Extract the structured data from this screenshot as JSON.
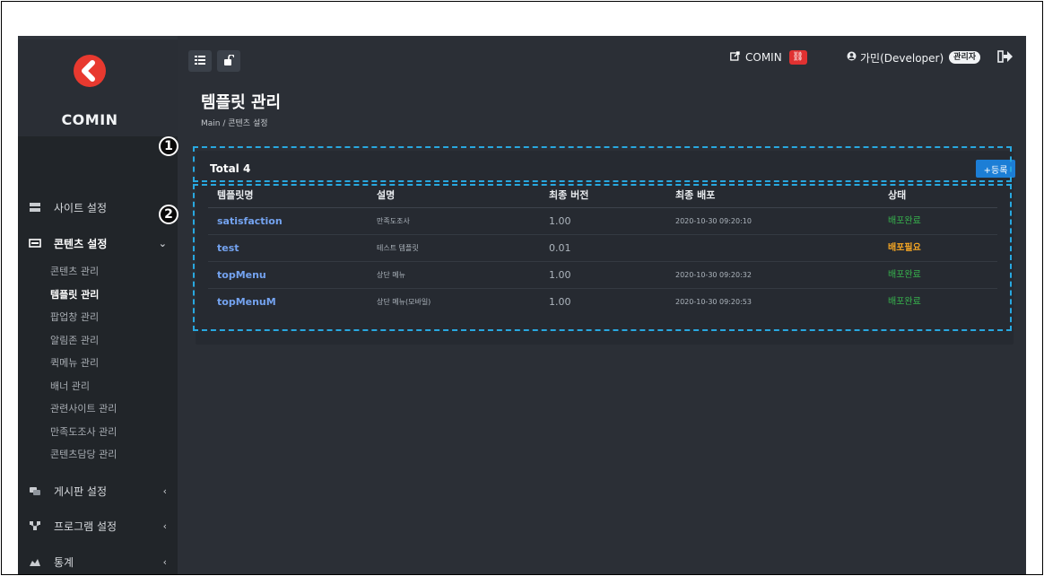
{
  "brand": {
    "name": "COMIN",
    "logo_color": "#e8392f"
  },
  "header": {
    "site_link": "COMIN",
    "user_name": "가민(Developer)",
    "role_badge": "관리자",
    "icons": [
      "list-icon",
      "unlock-icon",
      "external-link-icon",
      "link-icon",
      "user-icon",
      "logout-icon"
    ]
  },
  "sidebar": {
    "items": [
      {
        "label": "사이트 설정",
        "icon": "settings-panel-icon",
        "chevron": ""
      },
      {
        "label": "콘텐츠 설정",
        "icon": "content-icon",
        "chevron": "⌄"
      },
      {
        "label": "게시판 설정",
        "icon": "board-icon",
        "chevron": "‹"
      },
      {
        "label": "프로그램 설정",
        "icon": "program-icon",
        "chevron": "‹"
      },
      {
        "label": "통계",
        "icon": "chart-icon",
        "chevron": "‹"
      }
    ],
    "sub_items": [
      "콘텐츠 관리",
      "템플릿 관리",
      "팝업창 관리",
      "알림존 관리",
      "퀵메뉴 관리",
      "배너 관리",
      "관련사이트 관리",
      "만족도조사 관리",
      "콘텐츠담당 관리"
    ]
  },
  "page": {
    "title": "템플릿 관리",
    "breadcrumb": "Main / 콘텐츠 설정"
  },
  "card": {
    "total": "Total 4",
    "add_button": "+등록"
  },
  "table": {
    "headers": [
      "템플릿명",
      "설명",
      "최종 버전",
      "최종 배포",
      "상태"
    ],
    "rows": [
      {
        "name": "satisfaction",
        "desc": "만족도조사",
        "version": "1.00",
        "deployed": "2020-10-30 09:20:10",
        "status": "배포완료",
        "status_color": "#37b24d"
      },
      {
        "name": "test",
        "desc": "테스트 템플릿",
        "version": "0.01",
        "deployed": "",
        "status": "배포필요",
        "status_color": "#f5a623"
      },
      {
        "name": "topMenu",
        "desc": "상단 메뉴",
        "version": "1.00",
        "deployed": "2020-10-30 09:20:32",
        "status": "배포완료",
        "status_color": "#37b24d"
      },
      {
        "name": "topMenuM",
        "desc": "상단 메뉴(모바일)",
        "version": "1.00",
        "deployed": "2020-10-30 09:20:53",
        "status": "배포완료",
        "status_color": "#37b24d"
      }
    ]
  },
  "annotations": {
    "one": "1",
    "two": "2",
    "color": "#28a8e0"
  }
}
